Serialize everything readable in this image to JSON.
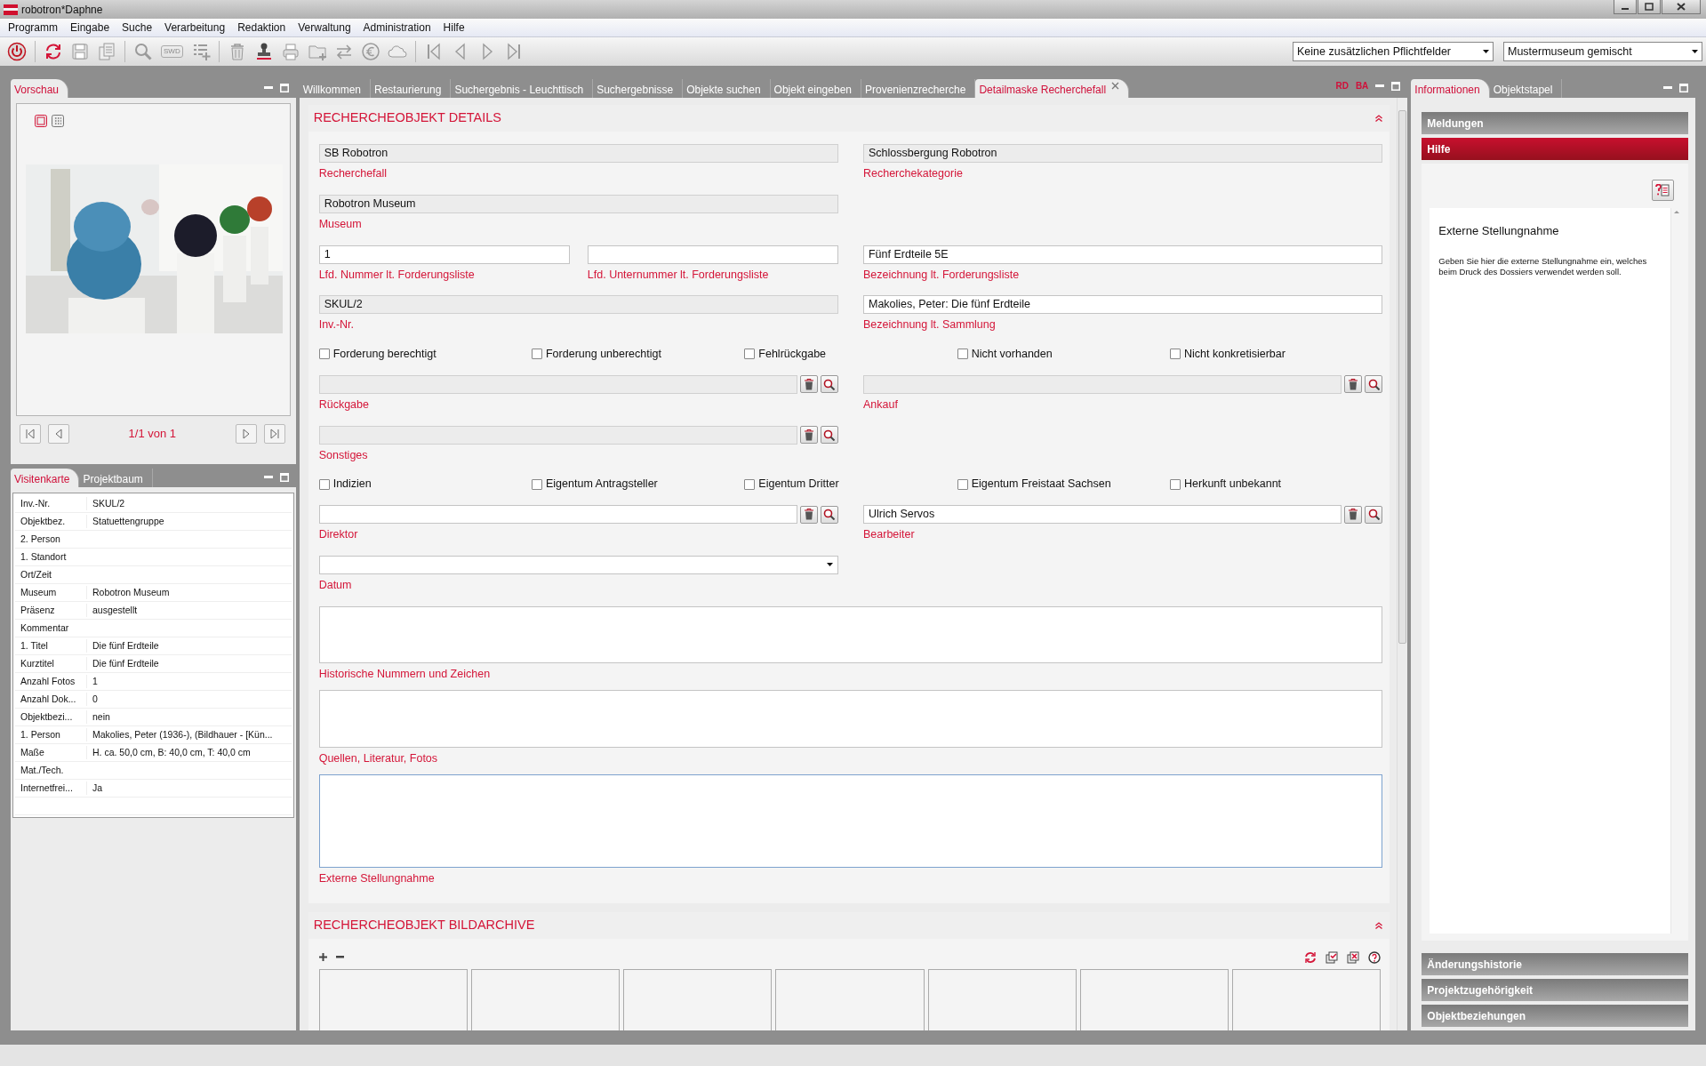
{
  "window": {
    "title": "robotron*Daphne"
  },
  "menu": [
    "Programm",
    "Eingabe",
    "Suche",
    "Verarbeitung",
    "Redaktion",
    "Verwaltung",
    "Administration",
    "Hilfe"
  ],
  "toolbar": {
    "swd": "SWD",
    "selects": [
      {
        "value": "Keine zusätzlichen Pflichtfelder"
      },
      {
        "value": "Mustermuseum gemischt"
      }
    ]
  },
  "preview": {
    "tabs": [
      {
        "label": "Vorschau",
        "selected": true
      }
    ],
    "views": [
      {
        "selected": true
      },
      {
        "selected": false
      }
    ],
    "pager": "1/1 von 1"
  },
  "card": {
    "tabs": [
      {
        "label": "Visitenkarte",
        "selected": true
      },
      {
        "label": "Projektbaum",
        "selected": false
      }
    ],
    "rows": [
      {
        "label": "Inv.-Nr.",
        "value": "SKUL/2"
      },
      {
        "label": "Objektbez.",
        "value": "Statuettengruppe"
      },
      {
        "label": "2. Person"
      },
      {
        "label": "1. Standort"
      },
      {
        "label": "Ort/Zeit"
      },
      {
        "label": "Museum",
        "value": "Robotron Museum"
      },
      {
        "label": "Präsenz",
        "value": "ausgestellt"
      },
      {
        "label": "Kommentar"
      },
      {
        "label": "1. Titel",
        "value": "Die fünf Erdteile"
      },
      {
        "label": "Kurztitel",
        "value": "Die fünf Erdteile"
      },
      {
        "label": "Anzahl Fotos",
        "value": "1"
      },
      {
        "label": "Anzahl Dok...",
        "value": "0"
      },
      {
        "label": "Objektbezi...",
        "value": "nein"
      },
      {
        "label": "1. Person",
        "value": "Makolies, Peter (1936-), (Bildhauer - [Kün..."
      },
      {
        "label": "Maße",
        "value": "H. ca. 50,0 cm, B: 40,0 cm, T: 40,0 cm"
      },
      {
        "label": "Mat./Tech."
      },
      {
        "label": "Internetfrei...",
        "value": "Ja"
      }
    ]
  },
  "main": {
    "tabs": [
      {
        "label": "Willkommen",
        "selected": false,
        "closable": false
      },
      {
        "label": "Restaurierung",
        "selected": false,
        "closable": false
      },
      {
        "label": "Suchergebnis - Leuchttisch",
        "selected": false,
        "closable": false
      },
      {
        "label": "Suchergebnisse",
        "selected": false,
        "closable": false
      },
      {
        "label": "Objekte suchen",
        "selected": false,
        "closable": false
      },
      {
        "label": "Objekt eingeben",
        "selected": false,
        "closable": false
      },
      {
        "label": "Provenienzrecherche",
        "selected": false,
        "closable": false
      },
      {
        "label": "Detailmaske Recherchefall",
        "selected": true,
        "closable": true
      }
    ],
    "flags": [
      "RD",
      "BA"
    ],
    "details": {
      "title": "RECHERCHEOBJEKT DETAILS",
      "rows": [
        {
          "kind": "fields",
          "left": [
            {
              "kind": "text",
              "label": "Recherchefall",
              "value": "SB Robotron",
              "readonly": true
            }
          ],
          "right": [
            {
              "kind": "text",
              "label": "Recherchekategorie",
              "value": "Schlossbergung Robotron",
              "readonly": true
            }
          ]
        },
        {
          "kind": "fields",
          "left": [
            {
              "kind": "text",
              "label": "Museum",
              "value": "Robotron Museum",
              "readonly": true
            }
          ]
        },
        {
          "kind": "fields",
          "left": [
            {
              "kind": "text",
              "label": "Lfd. Nummer lt. Forderungsliste",
              "value": "1",
              "readonly": false
            },
            {
              "kind": "text",
              "label": "Lfd. Unternummer lt. Forderungsliste",
              "readonly": false
            }
          ],
          "right": [
            {
              "kind": "text",
              "label": "Bezeichnung lt. Forderungsliste",
              "value": "Fünf Erdteile 5E",
              "readonly": false
            }
          ]
        },
        {
          "kind": "fields",
          "left": [
            {
              "kind": "text",
              "label": "Inv.-Nr.",
              "value": "SKUL/2",
              "readonly": true
            }
          ],
          "right": [
            {
              "kind": "text",
              "label": "Bezeichnung lt. Sammlung",
              "value": "Makolies, Peter: Die fünf Erdteile",
              "readonly": false
            }
          ]
        },
        {
          "kind": "checks",
          "items": [
            {
              "label": "Forderung berechtigt",
              "checked": false
            },
            {
              "label": "Forderung unberechtigt",
              "checked": false
            },
            {
              "label": "Fehlrückgabe",
              "checked": false
            },
            {
              "label": "Nicht vorhanden",
              "checked": false
            },
            {
              "label": "Nicht konkretisierbar",
              "checked": false
            }
          ]
        },
        {
          "kind": "fields",
          "left": [
            {
              "kind": "text",
              "label": "Rückgabe",
              "readonly": true,
              "lookup": true
            }
          ],
          "right": [
            {
              "kind": "text",
              "label": "Ankauf",
              "readonly": true,
              "lookup": true
            }
          ]
        },
        {
          "kind": "fields",
          "left": [
            {
              "kind": "text",
              "label": "Sonstiges",
              "readonly": true,
              "lookup": true
            }
          ]
        },
        {
          "kind": "checks",
          "items": [
            {
              "label": "Indizien",
              "checked": false
            },
            {
              "label": "Eigentum Antragsteller",
              "checked": false
            },
            {
              "label": "Eigentum Dritter",
              "checked": false
            },
            {
              "label": "Eigentum Freistaat Sachsen",
              "checked": false
            },
            {
              "label": "Herkunft unbekannt",
              "checked": false
            }
          ]
        },
        {
          "kind": "fields",
          "left": [
            {
              "kind": "text",
              "label": "Direktor",
              "readonly": false,
              "lookup": true
            }
          ],
          "right": [
            {
              "kind": "text",
              "label": "Bearbeiter",
              "value": "Ulrich Servos",
              "readonly": false,
              "lookup": true
            }
          ]
        },
        {
          "kind": "fields",
          "left": [
            {
              "kind": "select",
              "label": "Datum"
            }
          ]
        },
        {
          "kind": "textarea",
          "label": "Historische Nummern und Zeichen",
          "focused": false
        },
        {
          "kind": "textarea",
          "label": "Quellen, Literatur, Fotos",
          "focused": false
        },
        {
          "kind": "textarea",
          "label": "Externe Stellungnahme",
          "focused": true
        }
      ]
    },
    "images": {
      "title": "RECHERCHEOBJEKT BILDARCHIVE",
      "thumbnails": [
        {
          "kind": "empty"
        },
        {
          "kind": "empty"
        },
        {
          "kind": "empty"
        },
        {
          "kind": "empty"
        },
        {
          "kind": "empty"
        },
        {
          "kind": "empty"
        },
        {
          "kind": "empty"
        }
      ]
    }
  },
  "info": {
    "tabs": [
      {
        "label": "Informationen",
        "selected": true
      },
      {
        "label": "Objektstapel",
        "selected": false
      }
    ],
    "sections": [
      {
        "title": "Meldungen",
        "expanded": false
      },
      {
        "title": "Hilfe",
        "expanded": true,
        "help": {
          "title": "Externe Stellungnahme",
          "text": "Geben Sie hier die externe Stellungnahme ein, welches beim Druck des Dossiers verwendet werden soll."
        }
      },
      {
        "title": "Änderungshistorie",
        "expanded": false
      },
      {
        "title": "Projektzugehörigkeit",
        "expanded": false
      },
      {
        "title": "Objektbeziehungen",
        "expanded": false
      }
    ]
  }
}
